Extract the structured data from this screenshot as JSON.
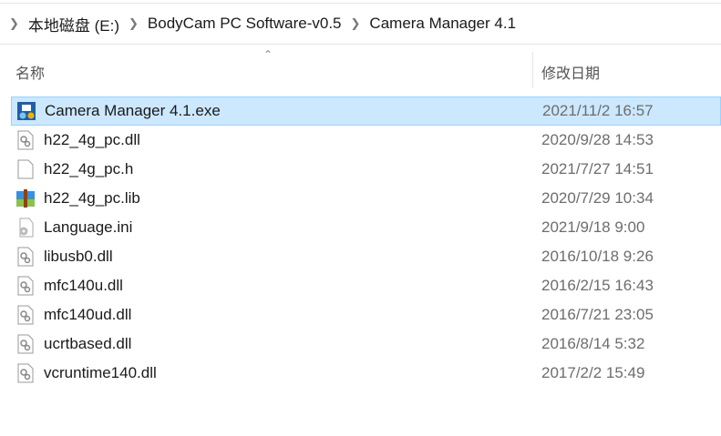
{
  "breadcrumb": [
    "本地磁盘 (E:)",
    "BodyCam PC Software-v0.5",
    "Camera Manager 4.1"
  ],
  "columns": {
    "name": "名称",
    "date": "修改日期"
  },
  "files": [
    {
      "name": "Camera Manager 4.1.exe",
      "date": "2021/11/2 16:57",
      "icon": "exe-icon",
      "selected": true
    },
    {
      "name": "h22_4g_pc.dll",
      "date": "2020/9/28 14:53",
      "icon": "dll-icon"
    },
    {
      "name": "h22_4g_pc.h",
      "date": "2021/7/27 14:51",
      "icon": "blank-file-icon"
    },
    {
      "name": "h22_4g_pc.lib",
      "date": "2020/7/29 10:34",
      "icon": "winrar-archive-icon"
    },
    {
      "name": "Language.ini",
      "date": "2021/9/18 9:00",
      "icon": "ini-settings-icon"
    },
    {
      "name": "libusb0.dll",
      "date": "2016/10/18 9:26",
      "icon": "dll-icon"
    },
    {
      "name": "mfc140u.dll",
      "date": "2016/2/15 16:43",
      "icon": "dll-icon"
    },
    {
      "name": "mfc140ud.dll",
      "date": "2016/7/21 23:05",
      "icon": "dll-icon"
    },
    {
      "name": "ucrtbased.dll",
      "date": "2016/8/14 5:32",
      "icon": "dll-icon"
    },
    {
      "name": "vcruntime140.dll",
      "date": "2017/2/2 15:49",
      "icon": "dll-icon"
    }
  ]
}
